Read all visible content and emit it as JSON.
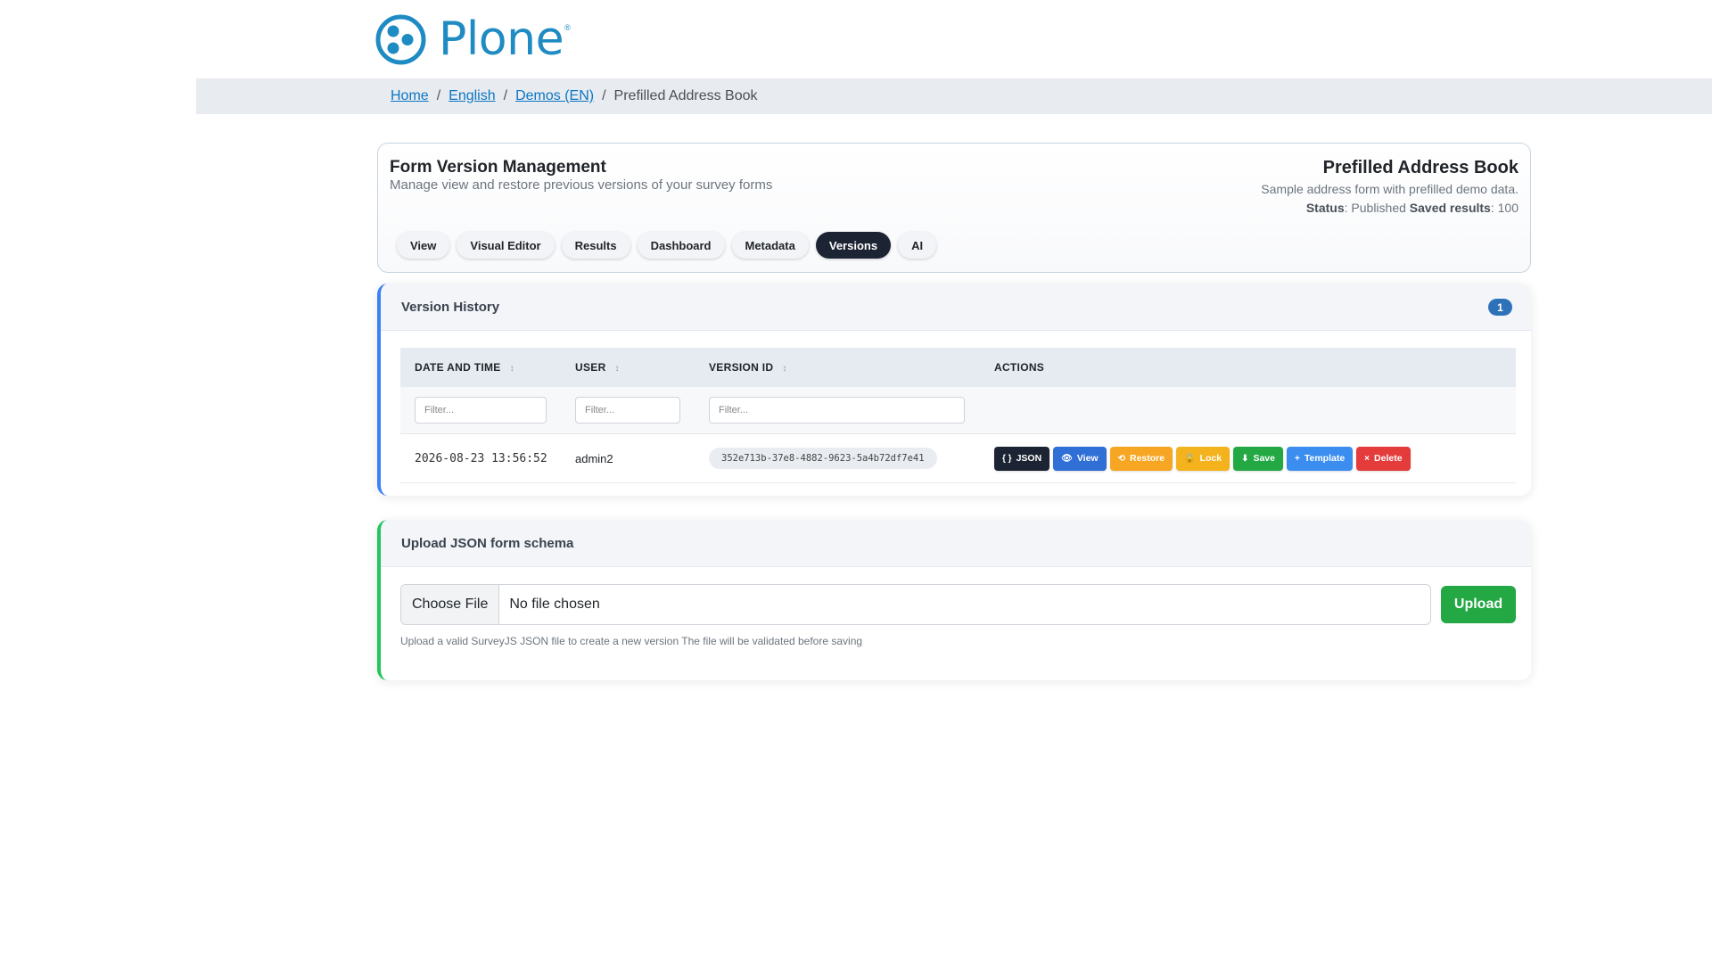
{
  "brand": {
    "name": "Plone",
    "reg": "®",
    "color": "#1f8bc3"
  },
  "breadcrumb": {
    "home": "Home",
    "english": "English",
    "demos": "Demos (EN)",
    "current": "Prefilled Address Book",
    "sep": "/"
  },
  "header": {
    "title": "Form Version Management",
    "subtitle": "Manage view and restore previous versions of your survey forms",
    "form_title": "Prefilled Address Book",
    "form_desc": "Sample address form with prefilled demo data.",
    "status_label": "Status",
    "status_value": ": Published ",
    "results_label": "Saved results",
    "results_value": ": 100"
  },
  "tabs": [
    {
      "label": "View",
      "active": false
    },
    {
      "label": "Visual Editor",
      "active": false
    },
    {
      "label": "Results",
      "active": false
    },
    {
      "label": "Dashboard",
      "active": false
    },
    {
      "label": "Metadata",
      "active": false
    },
    {
      "label": "Versions",
      "active": true
    },
    {
      "label": "AI",
      "active": false
    }
  ],
  "history": {
    "title": "Version History",
    "count": "1",
    "columns": {
      "date": "DATE AND TIME",
      "user": "USER",
      "version": "VERSION ID",
      "actions": "ACTIONS"
    },
    "filter_placeholder": "Filter...",
    "rows": [
      {
        "date": "2026-08-23 13:56:52",
        "user": "admin2",
        "version_id": "352e713b-37e8-4882-9623-5a4b72df7e41"
      }
    ],
    "actions": {
      "json": "JSON",
      "view": "View",
      "restore": "Restore",
      "lock": "Lock",
      "save": "Save",
      "template": "Template",
      "delete": "Delete"
    }
  },
  "upload": {
    "title": "Upload JSON form schema",
    "choose": "Choose File",
    "nofile": "No file chosen",
    "button": "Upload",
    "help": "Upload a valid SurveyJS JSON file to create a new version The file will be validated before saving"
  },
  "colors": {
    "accent_blue": "#3b82f6",
    "accent_green": "#22c55e",
    "dark": "#1c2333"
  }
}
